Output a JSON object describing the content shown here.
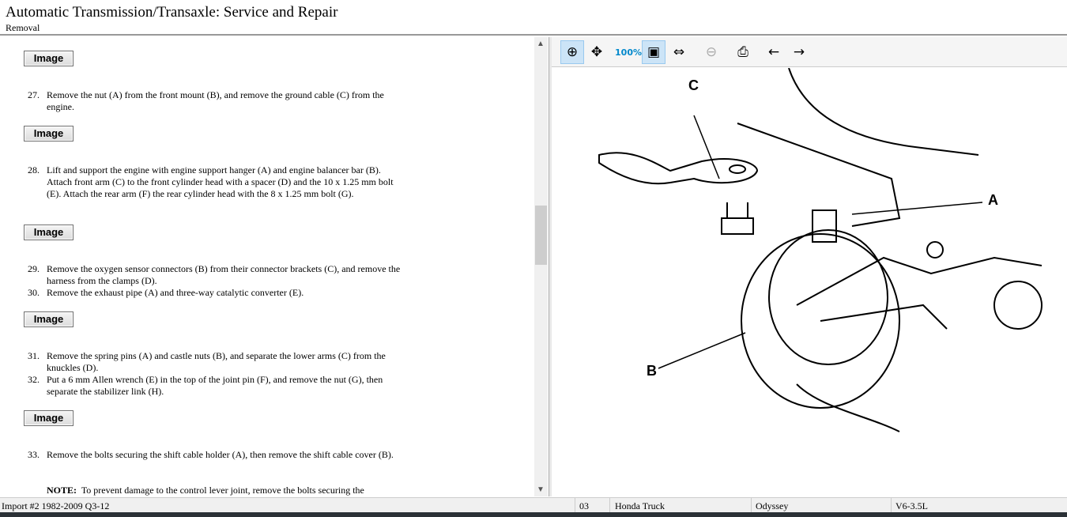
{
  "header": {
    "title": "Automatic Transmission/Transaxle:  Service and Repair",
    "subtitle": "Removal"
  },
  "image_button_label": "Image",
  "steps": [
    {
      "n": "27.",
      "text": "Remove the nut (A) from the front mount (B), and remove the ground cable (C) from the engine."
    },
    {
      "n": "28.",
      "text": "Lift and support the engine with engine support hanger (A) and engine balancer bar (B). Attach front arm (C) to the front cylinder head with a spacer (D) and the 10 x 1.25 mm bolt (E). Attach the rear arm (F) the rear cylinder head with the 8 x 1.25 mm bolt (G)."
    },
    {
      "n": "29.",
      "text": "Remove the oxygen sensor connectors (B) from their connector brackets (C), and remove the harness from the clamps (D)."
    },
    {
      "n": "30.",
      "text": "Remove the exhaust pipe (A) and three-way catalytic converter (E)."
    },
    {
      "n": "31.",
      "text": "Remove the spring pins (A) and castle nuts (B), and separate the lower arms (C) from the knuckles (D)."
    },
    {
      "n": "32.",
      "text": "Put a 6 mm Allen wrench (E) in the top of the joint pin (F), and remove the nut (G), then separate the stabilizer link (H)."
    },
    {
      "n": "33.",
      "text": "Remove the bolts securing the shift cable holder (A), then remove the shift cable cover (B)."
    }
  ],
  "note": {
    "label": "NOTE:",
    "text": "To prevent damage to the control lever joint, remove the bolts securing the"
  },
  "toolbar": [
    "zoom-in",
    "pan",
    "actual-size",
    "fit-window",
    "fit-width",
    "zoom-out",
    "print",
    "previous-image",
    "next-image"
  ],
  "diagram_labels": {
    "a": "A",
    "b": "B",
    "c": "C"
  },
  "status": {
    "source": "Import #2 1982-2009 Q3-12",
    "year": "03",
    "make": "Honda Truck",
    "model": "Odyssey",
    "engine": "V6-3.5L"
  }
}
